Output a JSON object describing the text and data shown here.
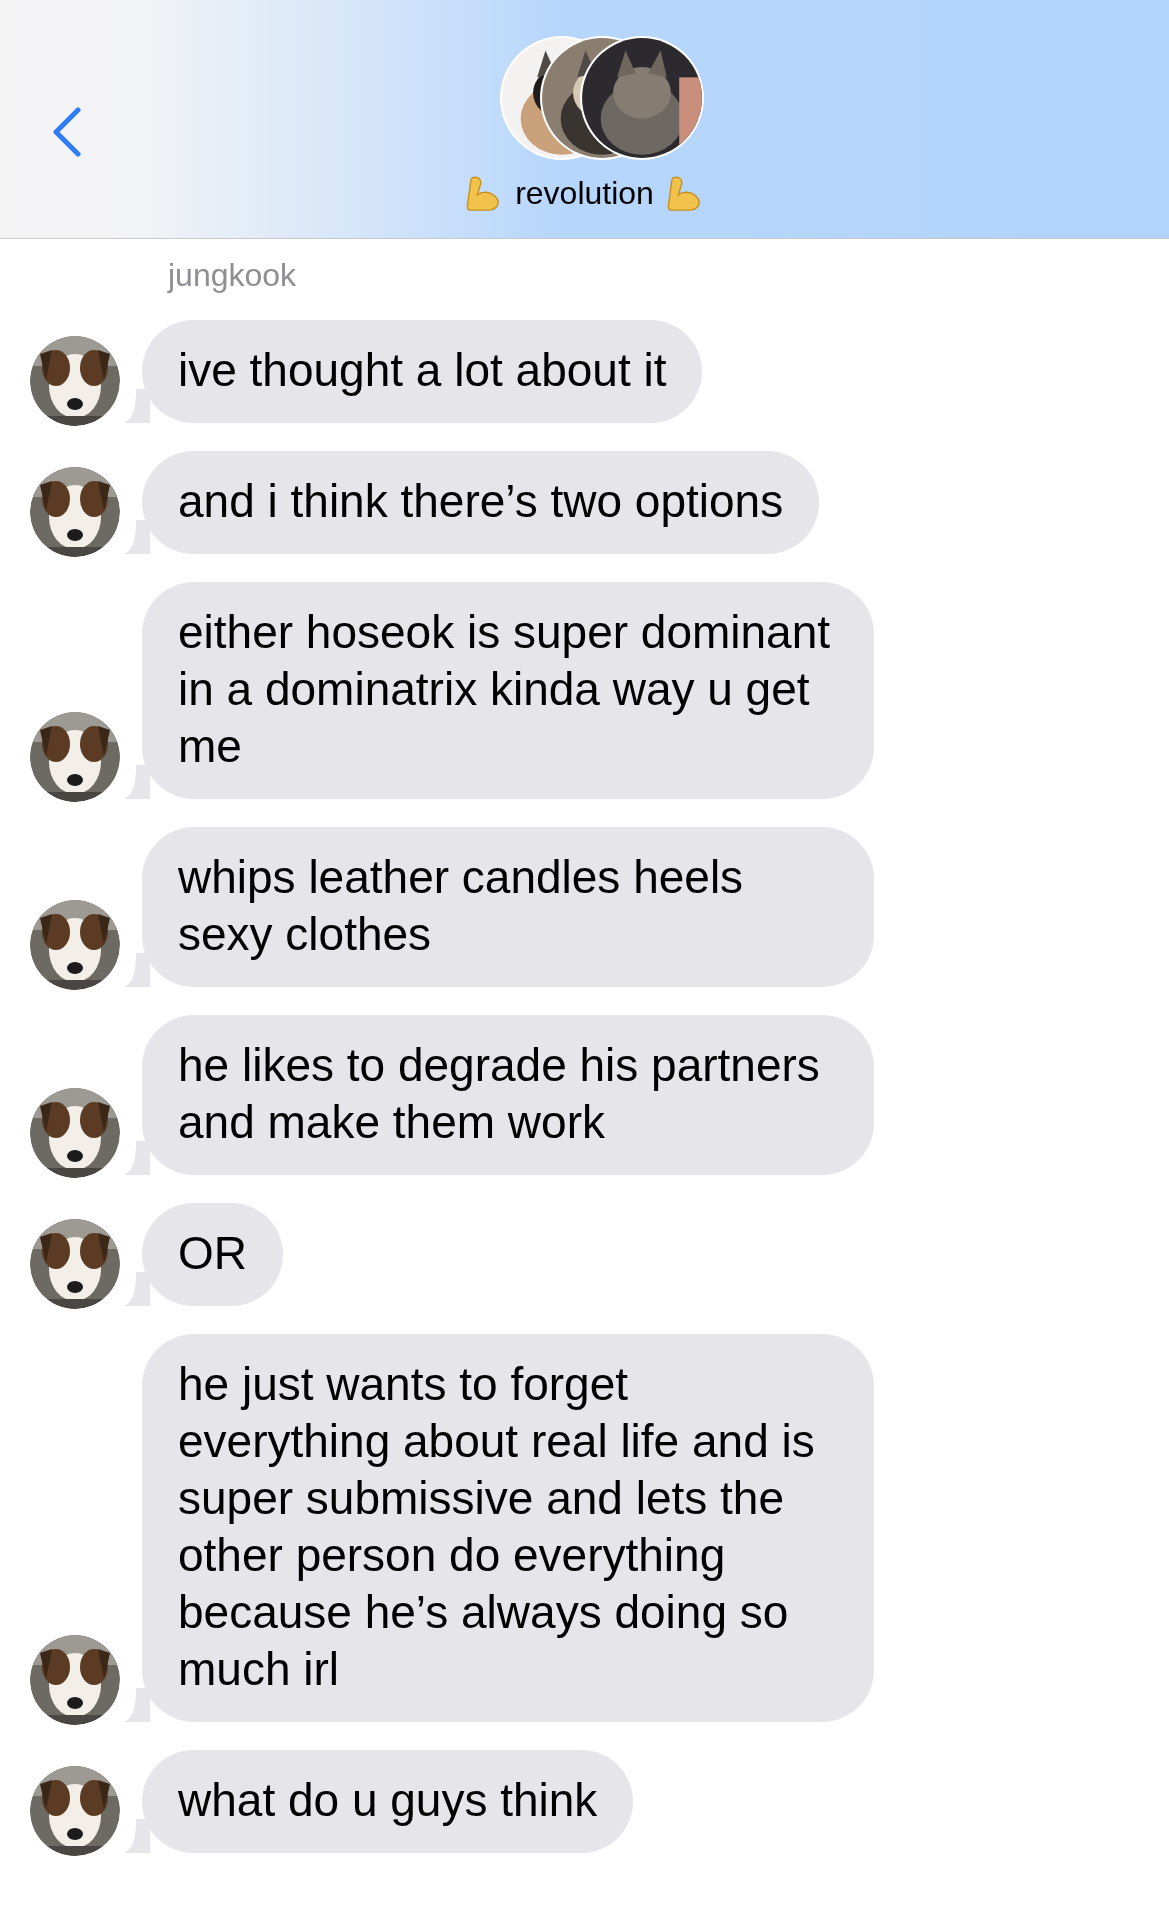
{
  "header": {
    "title": "revolution"
  },
  "sender": "jungkook",
  "messages": [
    {
      "text": "ive thought a lot about it"
    },
    {
      "text": "and i think there’s two options"
    },
    {
      "text": "either hoseok is super dominant in a dominatrix kinda way u get me"
    },
    {
      "text": "whips leather candles heels sexy clothes"
    },
    {
      "text": "he likes to degrade his partners and make them work"
    },
    {
      "text": "OR"
    },
    {
      "text": "he just wants to forget everything about real life and is super submissive and lets the other person do everything because he’s always doing so much irl"
    },
    {
      "text": "what do u guys think"
    }
  ]
}
